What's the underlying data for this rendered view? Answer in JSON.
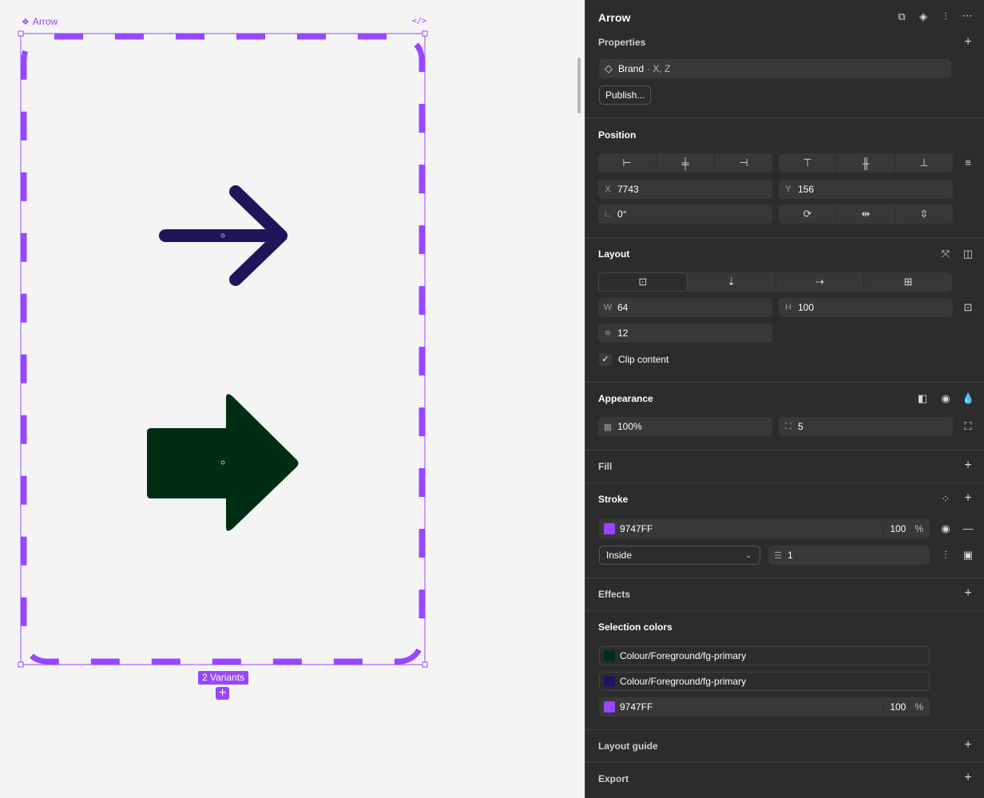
{
  "canvas": {
    "component_set_label": "Arrow",
    "code_icon": "</>",
    "variants_badge": "2 Variants",
    "add_variant_icon": "+",
    "colors": {
      "frame": "#9747FF",
      "arrow_stroke": "#20145A",
      "arrow_fill": "#002E14"
    }
  },
  "panel": {
    "title": "Arrow",
    "properties": {
      "title": "Properties",
      "property_name": "Brand",
      "property_values": "· X, Z",
      "publish_label": "Publish..."
    },
    "position": {
      "title": "Position",
      "x_label": "X",
      "x_value": "7743",
      "y_label": "Y",
      "y_value": "156",
      "rotation_value": "0°"
    },
    "layout": {
      "title": "Layout",
      "w_label": "W",
      "w_value": "64",
      "h_label": "H",
      "h_value": "100",
      "gap_value": "12",
      "clip_label": "Clip content"
    },
    "appearance": {
      "title": "Appearance",
      "opacity_value": "100%",
      "radius_value": "5"
    },
    "fill": {
      "title": "Fill"
    },
    "stroke": {
      "title": "Stroke",
      "color_hex": "9747FF",
      "color": "#9747FF",
      "opacity": "100",
      "percent": "%",
      "position": "Inside",
      "weight": "1"
    },
    "effects": {
      "title": "Effects"
    },
    "selection_colors": {
      "title": "Selection colors",
      "items": [
        {
          "label": "Colour/Foreground/fg-primary",
          "color": "#002E14"
        },
        {
          "label": "Colour/Foreground/fg-primary",
          "color": "#20145A"
        }
      ],
      "hex_item": {
        "label": "9747FF",
        "color": "#9747FF",
        "opacity": "100",
        "percent": "%"
      }
    },
    "layout_guide": {
      "title": "Layout guide"
    },
    "export": {
      "title": "Export"
    }
  }
}
